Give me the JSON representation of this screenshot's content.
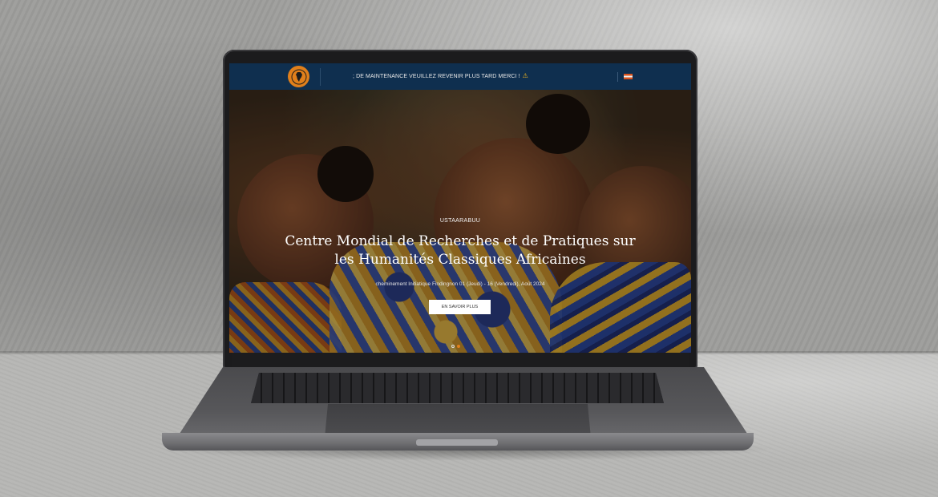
{
  "site": {
    "ticker": "; DE MAINTENANCE VEUILLEZ REVENIR PLUS TARD MERCI !",
    "ticker_icon": "warning-icon",
    "logo": "africa-globe-logo",
    "language_flag": "flag-icon"
  },
  "hero": {
    "kicker": "USTAARABUU",
    "headline_line1": "Centre Mondial de Recherches et de Pratiques sur",
    "headline_line2": "les Humanités Classiques Africaines",
    "subline": "cheminement Initiatique Findingnon 01 (Jeudi) - 16 (Vendredi), Août 2024",
    "cta_label": "EN SAVOIR PLUS",
    "slides": 2,
    "active_slide": 2
  },
  "colors": {
    "topbar": "#0f2f4f",
    "accent": "#e07f1b",
    "cta_bg": "#ffffff"
  }
}
